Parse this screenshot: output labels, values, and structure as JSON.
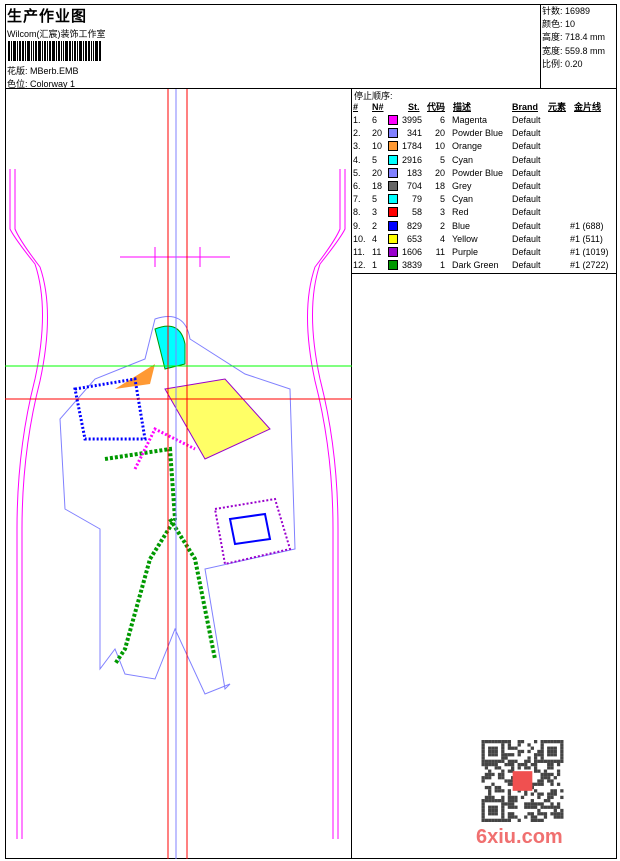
{
  "header": {
    "title": "生产作业图",
    "company": "Wilcom(汇宸)装饰工作室",
    "design_label": "花版:",
    "design": "MBerb.EMB",
    "colorway_label": "色位:",
    "colorway": "Colorway 1"
  },
  "info": [
    {
      "label": "针数:",
      "value": "16989"
    },
    {
      "label": "颜色:",
      "value": "10"
    },
    {
      "label": "高度:",
      "value": "718.4 mm"
    },
    {
      "label": "宽度:",
      "value": "559.8 mm"
    },
    {
      "label": "比例:",
      "value": "0.20"
    }
  ],
  "stop_sequence": {
    "caption": "停止顺序:",
    "headers": [
      "#",
      "N#",
      "St.",
      "代码",
      "描述",
      "Brand",
      "元素",
      "金片线"
    ],
    "rows": [
      {
        "i": "1.",
        "n": "6",
        "color": "#ff00ff",
        "st": "3995",
        "code": "6",
        "desc": "Magenta",
        "brand": "Default",
        "seq": ""
      },
      {
        "i": "2.",
        "n": "20",
        "color": "#8080ff",
        "st": "341",
        "code": "20",
        "desc": "Powder Blue",
        "brand": "Default",
        "seq": ""
      },
      {
        "i": "3.",
        "n": "10",
        "color": "#ff9933",
        "st": "1784",
        "code": "10",
        "desc": "Orange",
        "brand": "Default",
        "seq": ""
      },
      {
        "i": "4.",
        "n": "5",
        "color": "#00ffff",
        "st": "2916",
        "code": "5",
        "desc": "Cyan",
        "brand": "Default",
        "seq": ""
      },
      {
        "i": "5.",
        "n": "20",
        "color": "#8080ff",
        "st": "183",
        "code": "20",
        "desc": "Powder Blue",
        "brand": "Default",
        "seq": ""
      },
      {
        "i": "6.",
        "n": "18",
        "color": "#666666",
        "st": "704",
        "code": "18",
        "desc": "Grey",
        "brand": "Default",
        "seq": ""
      },
      {
        "i": "7.",
        "n": "5",
        "color": "#00ffff",
        "st": "79",
        "code": "5",
        "desc": "Cyan",
        "brand": "Default",
        "seq": ""
      },
      {
        "i": "8.",
        "n": "3",
        "color": "#ff0000",
        "st": "58",
        "code": "3",
        "desc": "Red",
        "brand": "Default",
        "seq": ""
      },
      {
        "i": "9.",
        "n": "2",
        "color": "#0000ff",
        "st": "829",
        "code": "2",
        "desc": "Blue",
        "brand": "Default",
        "seq": "#1 (688)"
      },
      {
        "i": "10.",
        "n": "4",
        "color": "#ffff00",
        "st": "653",
        "code": "4",
        "desc": "Yellow",
        "brand": "Default",
        "seq": "#1 (511)"
      },
      {
        "i": "11.",
        "n": "11",
        "color": "#9900cc",
        "st": "1606",
        "code": "11",
        "desc": "Purple",
        "brand": "Default",
        "seq": "#1 (1019)"
      },
      {
        "i": "12.",
        "n": "1",
        "color": "#009900",
        "st": "3839",
        "code": "1",
        "desc": "Dark Green",
        "brand": "Default",
        "seq": "#1 (2722)"
      }
    ]
  },
  "watermark": "6xiu.com"
}
